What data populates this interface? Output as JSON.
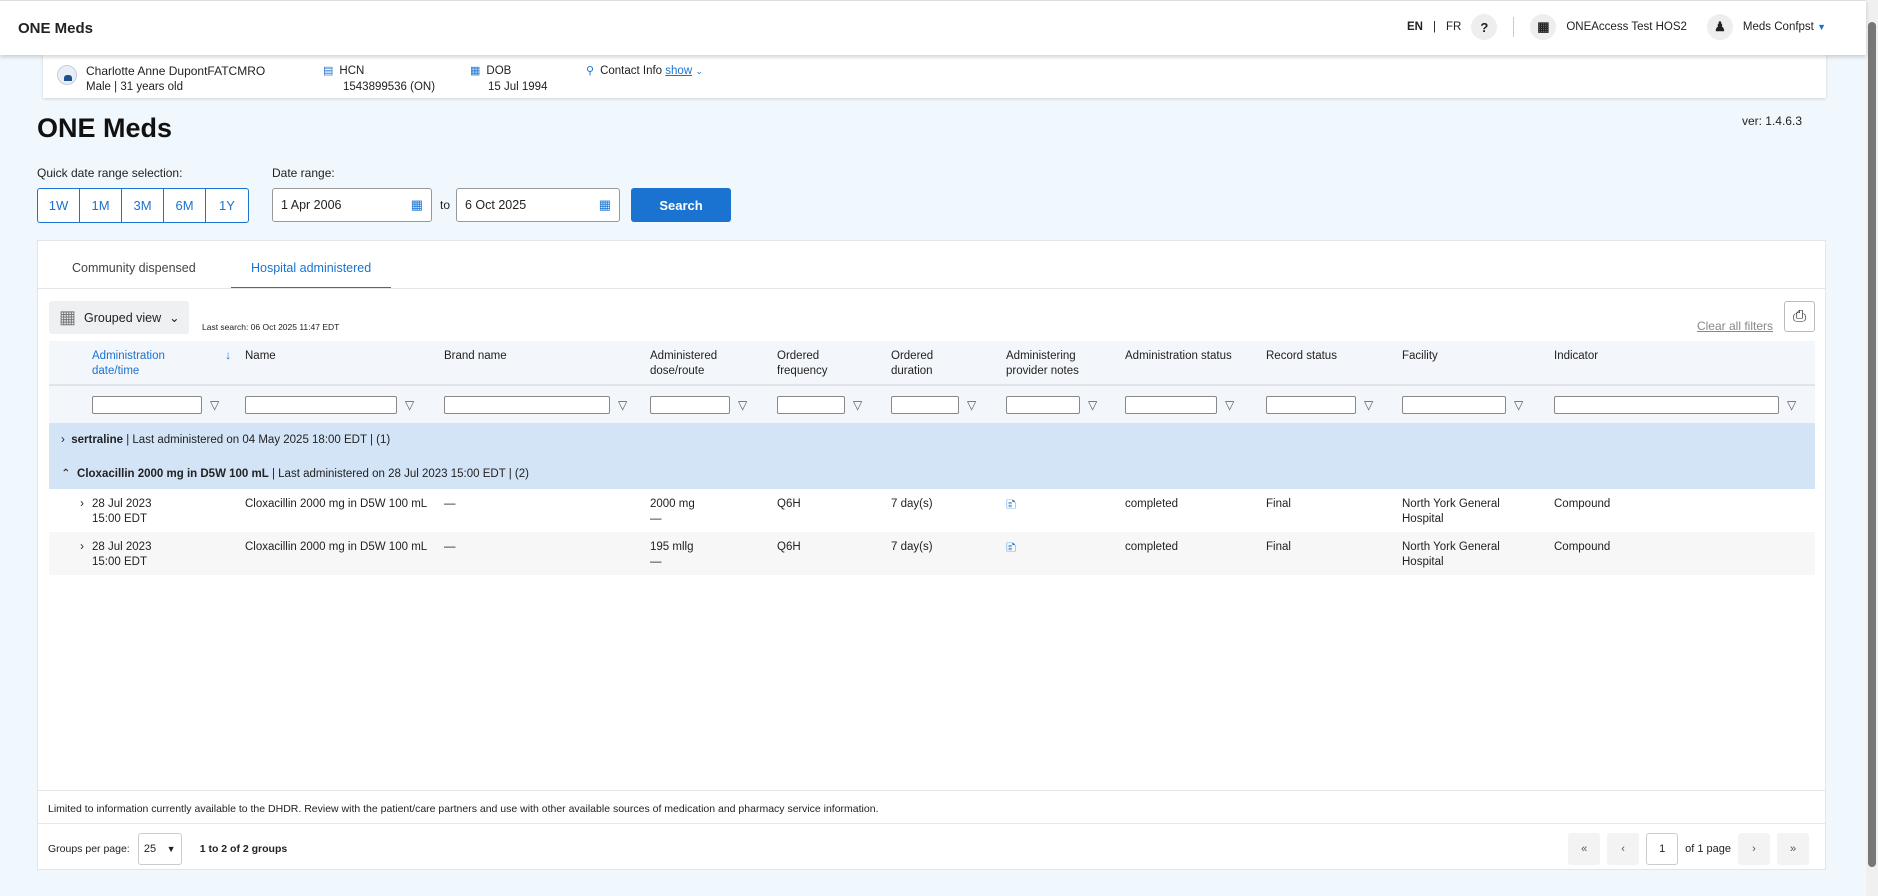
{
  "header": {
    "brand": "ONE Meds",
    "lang_en": "EN",
    "lang_sep": "|",
    "lang_fr": "FR",
    "help": "?",
    "org": "ONEAccess Test HOS2",
    "user": "Meds Confpst"
  },
  "patient": {
    "name": "Charlotte Anne DupontFATCMRO",
    "sex": "Male",
    "age": "31 years old",
    "hcn_label": "HCN",
    "hcn": "1543899536 (ON)",
    "dob_label": "DOB",
    "dob": "15 Jul 1994",
    "contact_label": "Contact Info",
    "contact_show": "show"
  },
  "page": {
    "title": "ONE Meds",
    "version": "ver: 1.4.6.3"
  },
  "filters": {
    "quick_label": "Quick date range selection:",
    "quick": [
      "1W",
      "1M",
      "3M",
      "6M",
      "1Y"
    ],
    "range_label": "Date range:",
    "from": "1 Apr 2006",
    "to_label": "to",
    "to": "6 Oct 2025",
    "search": "Search"
  },
  "tabs": [
    "Community dispensed",
    "Hospital administered"
  ],
  "toolbar": {
    "view": "Grouped view",
    "last_search": "Last search: 06 Oct 2025 11:47 EDT",
    "clear": "Clear all filters"
  },
  "columns": [
    "Administration date/time",
    "Name",
    "Brand name",
    "Administered dose/route",
    "Ordered frequency",
    "Ordered duration",
    "Administering provider notes",
    "Administration status",
    "Record status",
    "Facility",
    "Indicator"
  ],
  "groups": [
    {
      "name": "sertraline",
      "summary": "| Last administered on 04 May 2025 18:00 EDT | (1)",
      "expanded": false
    },
    {
      "name": "Cloxacillin 2000 mg in D5W 100 mL",
      "summary": "| Last administered on 28 Jul 2023 15:00 EDT | (2)",
      "expanded": true
    }
  ],
  "rows": [
    {
      "date": "28 Jul 2023",
      "time": "15:00 EDT",
      "name": "Cloxacillin 2000 mg in D5W 100 mL",
      "brand": "—",
      "dose": "2000 mg",
      "route": "—",
      "freq": "Q6H",
      "duration": "7 day(s)",
      "status": "completed",
      "record": "Final",
      "facility": "North York General Hospital",
      "indicator": "Compound"
    },
    {
      "date": "28 Jul 2023",
      "time": "15:00 EDT",
      "name": "Cloxacillin 2000 mg in D5W 100 mL",
      "brand": "—",
      "dose": "195 mllg",
      "route": "—",
      "freq": "Q6H",
      "duration": "7 day(s)",
      "status": "completed",
      "record": "Final",
      "facility": "North York General Hospital",
      "indicator": "Compound"
    }
  ],
  "footer": {
    "disclaimer": "Limited to information currently available to the DHDR. Review with the patient/care partners and use with other available sources of medication and pharmacy service information.",
    "per_page_label": "Groups per page:",
    "per_page": "25",
    "range": "1 to 2 of 2 groups",
    "page": "1",
    "of_pages": "of 1 page"
  }
}
